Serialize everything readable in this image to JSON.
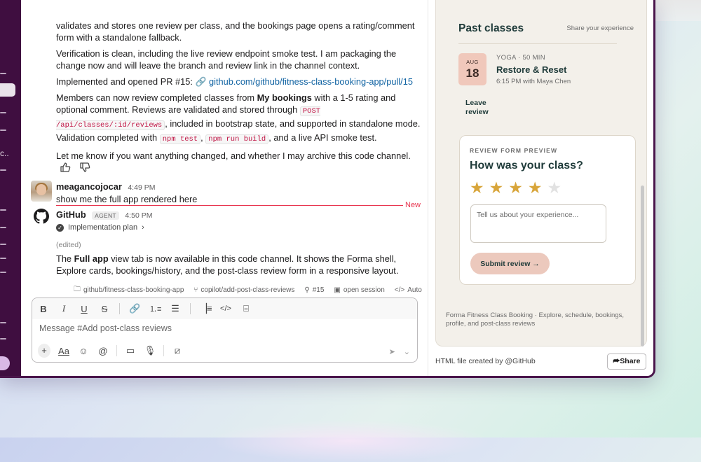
{
  "messages": {
    "p1": "validates and stores one review per class, and the bookings page opens a rating/comment form with a standalone fallback.",
    "p2": "Verification is clean, including the live review endpoint smoke test. I am packaging the change now and will leave the branch and review link in the channel context.",
    "p3_prefix": "Implemented and opened PR #15:",
    "p3_link": "github.com/github/fitness-class-booking-app/pull/15",
    "p4_a": "Members can now review completed classes from ",
    "p4_bold": "My bookings",
    "p4_b": " with a 1-5 rating and optional comment. Reviews are validated and stored through ",
    "p4_code1": "POST /api/classes/:id/reviews",
    "p4_c": ", included in bootstrap state, and supported in standalone mode. Validation completed with ",
    "p4_code2": "npm test",
    "p4_code3": "npm run build",
    "p4_d": ", and a live API smoke test.",
    "p5": "Let me know if you want anything changed, and whether I may archive this code channel."
  },
  "user_message": {
    "name": "meagancojocar",
    "time": "4:49 PM",
    "text": "show me the full app rendered here"
  },
  "new_label": "New",
  "bot_message": {
    "name": "GitHub",
    "badge": "AGENT",
    "time": "4:50 PM",
    "plan": "Implementation plan",
    "edited": "(edited)",
    "text_a": "The ",
    "text_bold": "Full app",
    "text_b": " view tab is now available in this code channel. It shows the Forma shell, Explore cards, bookings/history, and the post-class review form in a responsive layout."
  },
  "meta": {
    "repo": "github/fitness-class-booking-app",
    "branch": "copilot/add-post-class-reviews",
    "pr": "#15",
    "session": "open session",
    "mode": "Auto"
  },
  "composer": {
    "placeholder": "Message #Add post-class reviews"
  },
  "preview": {
    "title": "Past classes",
    "subtitle": "Share your experience",
    "month": "AUG",
    "day": "18",
    "class_type": "YOGA · 50 MIN",
    "class_name": "Restore & Reset",
    "class_time": "6:15 PM with Maya Chen",
    "leave_review": "Leave review",
    "form_label": "REVIEW FORM PREVIEW",
    "question": "How was your class?",
    "rating": 4,
    "rating_max": 5,
    "textarea_placeholder": "Tell us about your experience...",
    "submit": "Submit review →",
    "footer": "Forma Fitness Class Booking · Explore, schedule, bookings, profile, and post-class reviews"
  },
  "panel_footer": {
    "created": "HTML file created by @GitHub",
    "share": "Share"
  },
  "colors": {
    "sidebar": "#3f0e40",
    "link": "#1264a3",
    "new_line": "#e8344e",
    "star": "#d8a53a",
    "accent_peach": "#ecc9bd"
  }
}
